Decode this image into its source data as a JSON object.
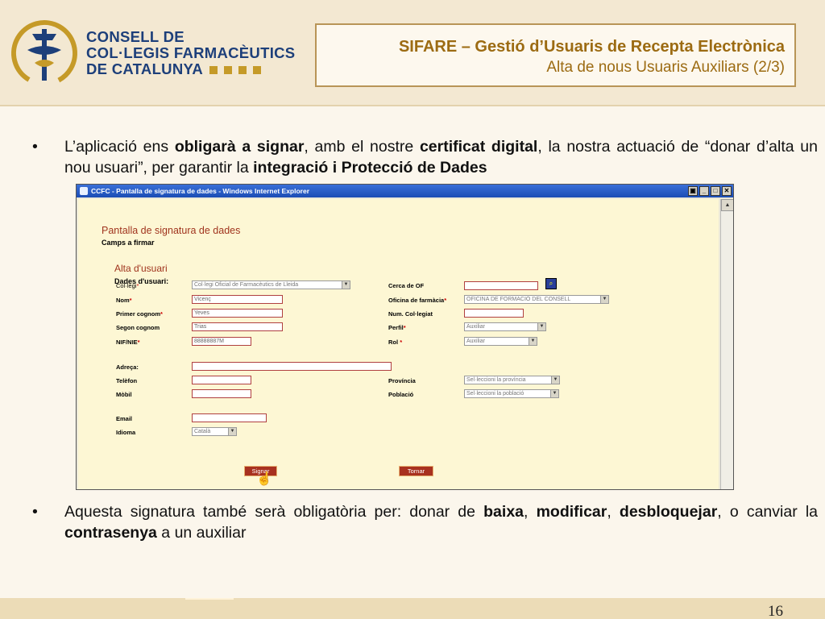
{
  "logo": {
    "line1": "CONSELL DE",
    "line2": "COL·LEGIS FARMACÈUTICS",
    "line3": "DE CATALUNYA",
    "colors": {
      "blue": "#1d3f7a",
      "gold": "#c59a28"
    }
  },
  "title": {
    "main": "SIFARE – Gestió d’Usuaris de Recepta Electrònica",
    "sub": "Alta de nous Usuaris Auxiliars (2/3)"
  },
  "bullet1": {
    "t1": "L’aplicació ens ",
    "b1": "obligarà a signar",
    "t2": ", amb el nostre ",
    "b2": "certificat digital",
    "t3": ", la nostra actuació de “donar d’alta un nou usuari”, per garantir la ",
    "b3": "integració i Protecció de Dades"
  },
  "window": {
    "title": "CCFC - Pantalla de signatura de dades - Windows Internet Explorer",
    "page_title": "Pantalla de signatura de dades",
    "page_sub": "Camps a firmar",
    "section_title": "Alta d'usuari",
    "section_sub": "Dades d'usuari:",
    "fields": {
      "collegi": {
        "label": "Col·legi",
        "value": "Col·legi Oficial de Farmacèutics de Lleida"
      },
      "nom": {
        "label": "Nom",
        "value": "Vicenç"
      },
      "cognom1": {
        "label": "Primer cognom",
        "value": "Yeves"
      },
      "cognom2": {
        "label": "Segon cognom",
        "value": "Trias"
      },
      "nif": {
        "label": "NIF/NIE",
        "value": "88888887M"
      },
      "adreca": {
        "label": "Adreça:",
        "value": ""
      },
      "telefon": {
        "label": "Telèfon",
        "value": ""
      },
      "mobil": {
        "label": "Mòbil",
        "value": ""
      },
      "email": {
        "label": "Email",
        "value": ""
      },
      "idioma": {
        "label": "Idioma",
        "value": "Català"
      },
      "cerca": {
        "label": "Cerca de OF",
        "value": ""
      },
      "oficina": {
        "label": "Oficina de farmàcia",
        "value": "OFICINA DE FORMACIÓ DEL CONSELL"
      },
      "numcol": {
        "label": "Num. Col·legiat",
        "value": ""
      },
      "perfil": {
        "label": "Perfil",
        "value": "Auxiliar"
      },
      "rol": {
        "label": "Rol",
        "value": "Auxiliar"
      },
      "provincia": {
        "label": "Província",
        "value": "Sel·leccioni la província"
      },
      "poblacio": {
        "label": "Població",
        "value": "Sel·leccioni la població"
      }
    },
    "required_mark": "*",
    "sign_button": "Signar",
    "back_button": "Tornar"
  },
  "bullet2": {
    "t1": "Aquesta signatura també serà obligatòria per: donar de ",
    "b1": "baixa",
    "t2": ", ",
    "b2": "modificar",
    "t3": ", ",
    "b3": "desbloquejar",
    "t4": ", o canviar la ",
    "b4": "contrasenya",
    "t5": " a un auxiliar"
  },
  "footer": {
    "page_number": "16"
  }
}
